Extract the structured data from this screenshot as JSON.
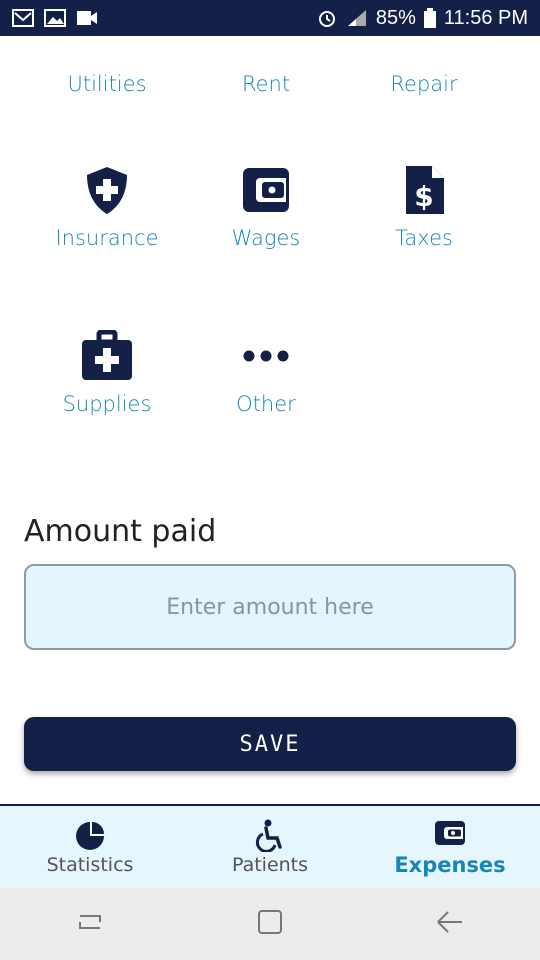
{
  "status_bar": {
    "battery": "85%",
    "time": "11:56 PM",
    "left_icons": [
      "gmail-icon",
      "gallery-icon",
      "video-icon"
    ],
    "right_icons": [
      "alarm-icon",
      "signal-icon",
      "battery-icon"
    ]
  },
  "categories": [
    {
      "label": "Utilities",
      "icon": "utilities-icon"
    },
    {
      "label": "Rent",
      "icon": "rent-icon"
    },
    {
      "label": "Repair",
      "icon": "repair-icon"
    },
    {
      "label": "Insurance",
      "icon": "shield-plus-icon"
    },
    {
      "label": "Wages",
      "icon": "wallet-icon"
    },
    {
      "label": "Taxes",
      "icon": "dollar-document-icon"
    },
    {
      "label": "Supplies",
      "icon": "first-aid-kit-icon"
    },
    {
      "label": "Other",
      "icon": "ellipsis-icon"
    }
  ],
  "amount": {
    "title": "Amount paid",
    "placeholder": "Enter amount here",
    "value": ""
  },
  "save_label": "SAVE",
  "tabs": [
    {
      "label": "Statistics",
      "icon": "pie-chart-icon",
      "active": false
    },
    {
      "label": "Patients",
      "icon": "wheelchair-icon",
      "active": false
    },
    {
      "label": "Expenses",
      "icon": "wallet-icon",
      "active": true
    }
  ],
  "colors": {
    "navy": "#142047",
    "accent": "#1586b5",
    "input_bg": "#e3f5fd"
  }
}
